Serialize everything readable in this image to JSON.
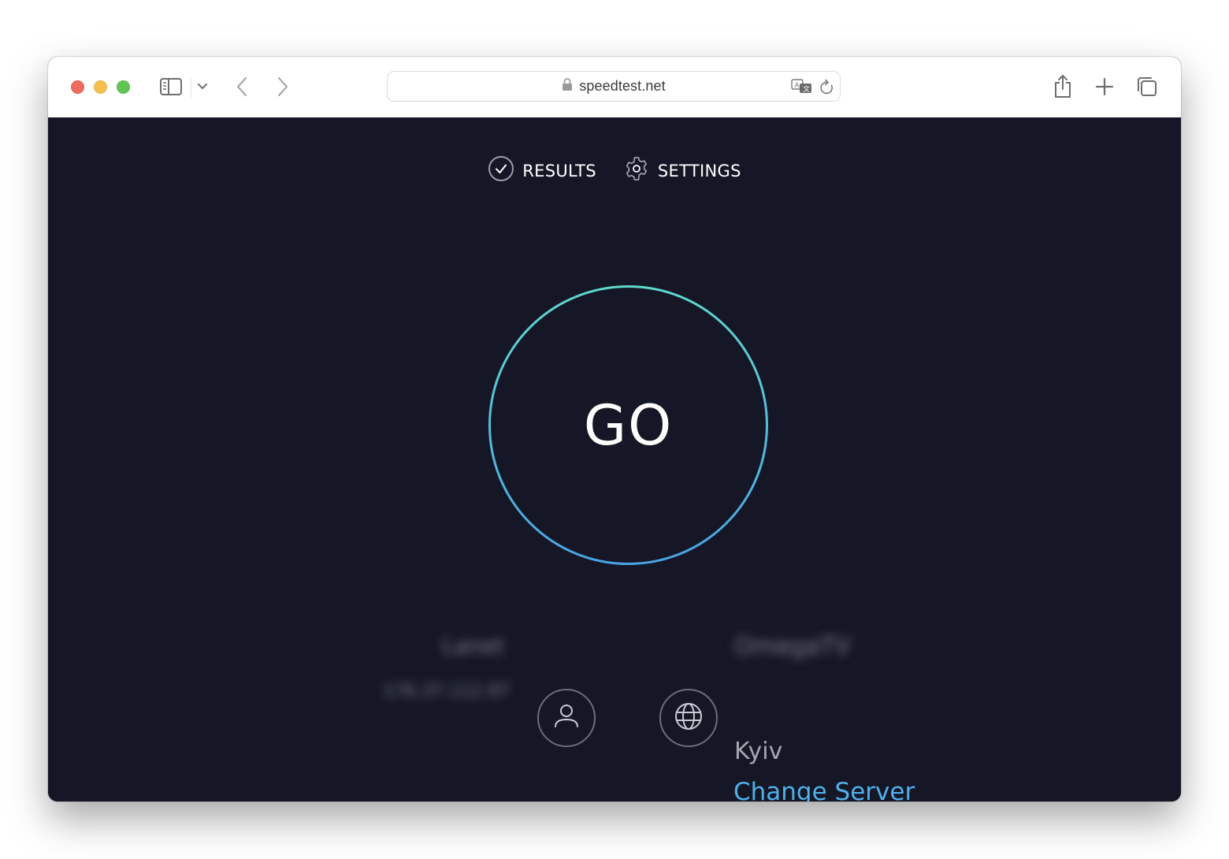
{
  "browser": {
    "url": "speedtest.net",
    "icons": {
      "close": "red-traffic-light",
      "minimize": "yellow-traffic-light",
      "zoom": "green-traffic-light",
      "sidebar": "sidebar-icon",
      "sidebar_menu": "chevron-down-icon",
      "back": "chevron-left-icon",
      "forward": "chevron-right-icon",
      "lock": "lock-icon",
      "translate": "translate-icon",
      "reload": "reload-icon",
      "share": "share-icon",
      "new_tab": "plus-icon",
      "tab_overview": "tabs-icon"
    },
    "colors": {
      "close": "#ed6a5e",
      "minimize": "#f5bf4f",
      "zoom": "#61c554"
    }
  },
  "page": {
    "nav": {
      "results_label": "RESULTS",
      "settings_label": "SETTINGS"
    },
    "go_button": {
      "label": "GO",
      "ring_gradient": [
        "#5fd9cd",
        "#4aa3e6"
      ]
    },
    "isp": {
      "name": "Lanet",
      "ip": "176.37.112.97",
      "blurred": true
    },
    "server": {
      "name": "OmegaTV",
      "name_blurred": true,
      "city": "Kyiv",
      "change_label": "Change Server"
    },
    "colors": {
      "background": "#151726",
      "link": "#4fb0ea",
      "muted_text": "#a4a6b0"
    }
  }
}
